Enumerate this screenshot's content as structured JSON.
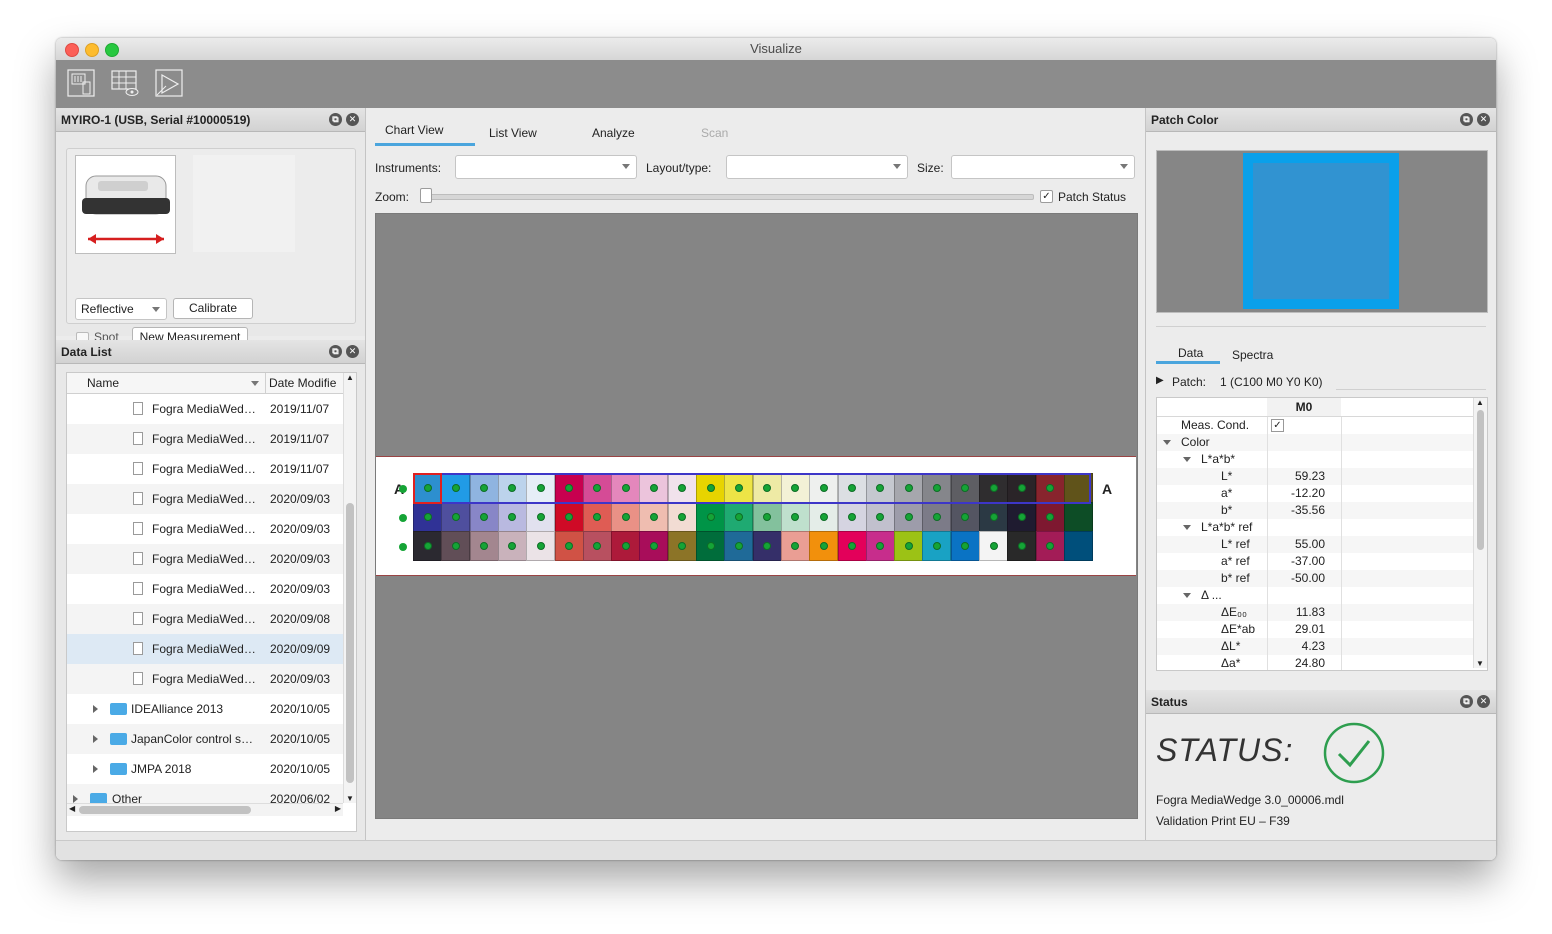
{
  "window": {
    "title": "Visualize"
  },
  "toolbar": {
    "buttons": [
      "measure-icon",
      "view-icon",
      "report-icon"
    ]
  },
  "instrument_panel": {
    "title": "MYIRO-1 (USB, Serial #10000519)",
    "mode_value": "Reflective",
    "calibrate_label": "Calibrate",
    "spot_label": "Spot",
    "new_measurement_label": "New Measurement"
  },
  "data_list": {
    "title": "Data List",
    "col_name": "Name",
    "col_date": "Date Modifie",
    "rows": [
      {
        "name": "Fogra MediaWed…",
        "date": "2019/11/07",
        "kind": "file"
      },
      {
        "name": "Fogra MediaWed…",
        "date": "2019/11/07",
        "kind": "file"
      },
      {
        "name": "Fogra MediaWed…",
        "date": "2019/11/07",
        "kind": "file"
      },
      {
        "name": "Fogra MediaWed…",
        "date": "2020/09/03",
        "kind": "file"
      },
      {
        "name": "Fogra MediaWed…",
        "date": "2020/09/03",
        "kind": "file"
      },
      {
        "name": "Fogra MediaWed…",
        "date": "2020/09/03",
        "kind": "file"
      },
      {
        "name": "Fogra MediaWed…",
        "date": "2020/09/03",
        "kind": "file"
      },
      {
        "name": "Fogra MediaWed…",
        "date": "2020/09/08",
        "kind": "file"
      },
      {
        "name": "Fogra MediaWed…",
        "date": "2020/09/09",
        "kind": "file"
      },
      {
        "name": "Fogra MediaWed…",
        "date": "2020/09/03",
        "kind": "file"
      },
      {
        "name": "IDEAlliance 2013",
        "date": "2020/10/05",
        "kind": "folder"
      },
      {
        "name": "JapanColor control s…",
        "date": "2020/10/05",
        "kind": "folder"
      },
      {
        "name": "JMPA 2018",
        "date": "2020/10/05",
        "kind": "folder"
      },
      {
        "name": "Other",
        "date": "2020/06/02",
        "kind": "folder-top"
      }
    ],
    "selected_index": 8
  },
  "center": {
    "tabs": [
      "Chart View",
      "List View",
      "Analyze",
      "Scan"
    ],
    "active_tab": "Chart View",
    "instruments_label": "Instruments:",
    "layout_label": "Layout/type:",
    "size_label": "Size:",
    "zoom_label": "Zoom:",
    "patch_status_label": "Patch Status",
    "row_letter": "A"
  },
  "chart_rows": [
    [
      "#2d8fcf",
      "#219be6",
      "#8fb4e0",
      "#bcd3ec",
      "#e6eef7",
      "#c8004f",
      "#d54b96",
      "#e487bc",
      "#ecc4dc",
      "#f1e2ec",
      "#e7d400",
      "#ede446",
      "#eeeaa5",
      "#f3f1d6",
      "#eef0ee",
      "#dcdfe3",
      "#c5c8cf",
      "#a6a7ad",
      "#85868b",
      "#5e5e63",
      "#2f2d2f",
      "#2a2428",
      "#88242d",
      "#60531a"
    ],
    [
      "#303296",
      "#4f4f9e",
      "#8886c7",
      "#b9b9e0",
      "#e1e1ef",
      "#cf0a26",
      "#df5c54",
      "#e99186",
      "#efbdb0",
      "#f2dcd3",
      "#009447",
      "#1faa72",
      "#83c19d",
      "#bfe0cd",
      "#e4ede8",
      "#d5d4e1",
      "#c1c0cd",
      "#9d9caa",
      "#7c7b88",
      "#545562",
      "#2b3944",
      "#1f1b30",
      "#7e1830",
      "#0d4d26"
    ],
    [
      "#2b2930",
      "#614e57",
      "#a3868f",
      "#c9b2bb",
      "#ebe3e7",
      "#d05245",
      "#b85060",
      "#ad1a3a",
      "#a80d5a",
      "#8c7427",
      "#006d3b",
      "#1f6a98",
      "#352f69",
      "#ea9e94",
      "#f2900c",
      "#e3005a",
      "#c72d8c",
      "#9cc215",
      "#19a2c4",
      "#0a73c4",
      "#f4f4f4",
      "#292929",
      "#a31c57",
      "#004f7b"
    ]
  ],
  "patch_color": {
    "title": "Patch Color",
    "swatch_measured": "#3193d1",
    "swatch_ref": "#0aa0ea",
    "tabs": [
      "Data",
      "Spectra"
    ],
    "active_tab": "Data",
    "patch_label": "Patch:",
    "patch_value": "1 (C100 M0 Y0 K0)",
    "col_header": "M0",
    "rows": [
      {
        "label": "Meas. Cond.",
        "value": "✓",
        "indent": 0,
        "kind": "check"
      },
      {
        "label": "Color",
        "value": "",
        "indent": 0,
        "kind": "group"
      },
      {
        "label": "L*a*b*",
        "value": "",
        "indent": 1,
        "kind": "group"
      },
      {
        "label": "L*",
        "value": "59.23",
        "indent": 2,
        "kind": "value"
      },
      {
        "label": "a*",
        "value": "-12.20",
        "indent": 2,
        "kind": "value"
      },
      {
        "label": "b*",
        "value": "-35.56",
        "indent": 2,
        "kind": "value"
      },
      {
        "label": "L*a*b* ref",
        "value": "",
        "indent": 1,
        "kind": "group"
      },
      {
        "label": "L* ref",
        "value": "55.00",
        "indent": 2,
        "kind": "value"
      },
      {
        "label": "a* ref",
        "value": "-37.00",
        "indent": 2,
        "kind": "value"
      },
      {
        "label": "b* ref",
        "value": "-50.00",
        "indent": 2,
        "kind": "value"
      },
      {
        "label": "Δ ...",
        "value": "",
        "indent": 1,
        "kind": "group"
      },
      {
        "label": "ΔE₀₀",
        "value": "11.83",
        "indent": 2,
        "kind": "value"
      },
      {
        "label": "ΔE*ab",
        "value": "29.01",
        "indent": 2,
        "kind": "value"
      },
      {
        "label": "ΔL*",
        "value": "4.23",
        "indent": 2,
        "kind": "value"
      },
      {
        "label": "Δa*",
        "value": "24.80",
        "indent": 2,
        "kind": "value"
      }
    ]
  },
  "status": {
    "title": "Status",
    "heading": "STATUS:",
    "file": "Fogra MediaWedge 3.0_00006.mdl",
    "validation": "Validation Print EU – F39",
    "ok_color": "#2e9e4f"
  }
}
